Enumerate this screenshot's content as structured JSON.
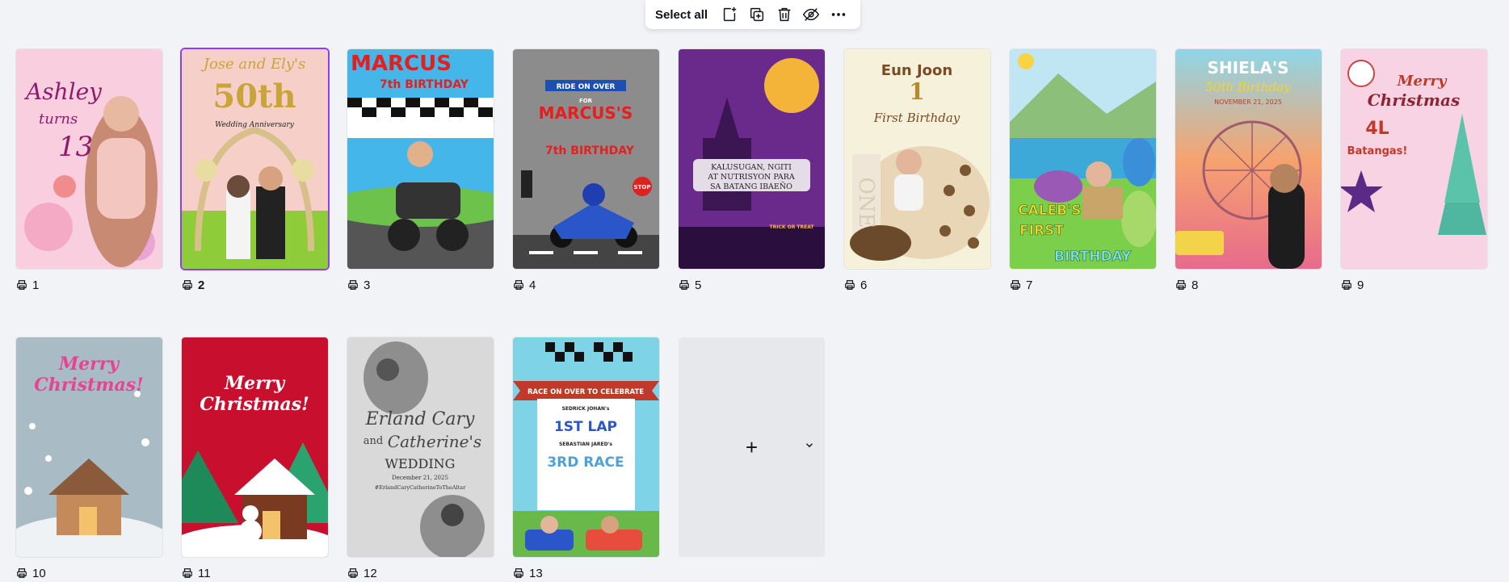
{
  "toolbar": {
    "select_all_label": "Select all",
    "buttons": [
      {
        "icon": "add-page-icon"
      },
      {
        "icon": "duplicate-icon"
      },
      {
        "icon": "trash-icon"
      },
      {
        "icon": "hide-icon"
      },
      {
        "icon": "more-icon"
      }
    ]
  },
  "pages": [
    {
      "number": "1",
      "texts": [
        "Ashley",
        "turns",
        "13"
      ]
    },
    {
      "number": "2",
      "selected": true,
      "texts": [
        "Jose and Ely's",
        "50th",
        "Wedding Anniversary"
      ]
    },
    {
      "number": "3",
      "texts": [
        "MARCUS",
        "7th BIRTHDAY"
      ]
    },
    {
      "number": "4",
      "texts": [
        "RIDE ON OVER",
        "FOR",
        "MARCUS'S",
        "7th BIRTHDAY",
        "STOP"
      ]
    },
    {
      "number": "5",
      "texts": [
        "KALUSUGAN, NGITI",
        "AT NUTRISYON PARA",
        "SA BATANG IBAEÑO",
        "TRICK OR TREAT"
      ]
    },
    {
      "number": "6",
      "texts": [
        "Eun Joon",
        "1",
        "First Birthday",
        "ONE"
      ]
    },
    {
      "number": "7",
      "texts": [
        "CALEB'S",
        "FIRST",
        "BIRTHDAY"
      ]
    },
    {
      "number": "8",
      "texts": [
        "SHIELA'S",
        "50th Birthday",
        "NOVEMBER 21, 2025"
      ]
    },
    {
      "number": "9",
      "texts": [
        "Merry",
        "Christmas",
        "4L",
        "Batangas!"
      ]
    },
    {
      "number": "10",
      "texts": [
        "Merry",
        "Christmas!"
      ]
    },
    {
      "number": "11",
      "texts": [
        "Merry",
        "Christmas!"
      ]
    },
    {
      "number": "12",
      "texts": [
        "Erland Cary",
        "and",
        "Catherine's",
        "WEDDING",
        "December 21, 2025",
        "#ErlandCaryCatherineToTheAltar"
      ]
    },
    {
      "number": "13",
      "texts": [
        "RACE ON OVER TO CELEBRATE",
        "SEDRICK JOHAN's",
        "1ST LAP",
        "SEBASTIAN JARED's",
        "3RD RACE"
      ]
    }
  ],
  "add_page": {
    "plus_symbol": "+",
    "chevron_icon": "chevron-down-icon"
  },
  "page_label_icon": "print-icon",
  "colors": {
    "background": "#f2f3f6",
    "selected_outline": "#8b3dff",
    "text": "#0e1318"
  }
}
